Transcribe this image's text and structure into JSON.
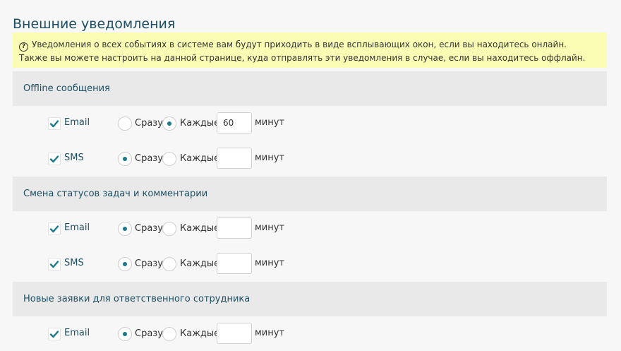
{
  "page": {
    "title": "Внешние уведомления",
    "info_line1": "Уведомления о всех событиях в системе вам будут приходить в виде всплывающих окон, если вы находитесь онлайн.",
    "info_line2": "Также вы можете настроить на данной странице, куда отправлять эти уведомления в случае, если вы находитесь оффлайн."
  },
  "options": {
    "now_label": "Сразу",
    "every_label": "Каждые",
    "unit_label": "минут"
  },
  "sections": [
    {
      "title": "Offline сообщения",
      "rows": [
        {
          "channel": "Email",
          "enabled": true,
          "mode": "every",
          "minutes": "60"
        },
        {
          "channel": "SMS",
          "enabled": true,
          "mode": "now",
          "minutes": ""
        }
      ]
    },
    {
      "title": "Смена статусов задач и комментарии",
      "rows": [
        {
          "channel": "Email",
          "enabled": true,
          "mode": "now",
          "minutes": ""
        },
        {
          "channel": "SMS",
          "enabled": true,
          "mode": "now",
          "minutes": ""
        }
      ]
    },
    {
      "title": "Новые заявки для ответственного сотрудника",
      "rows": [
        {
          "channel": "Email",
          "enabled": true,
          "mode": "now",
          "minutes": ""
        }
      ]
    }
  ],
  "colors": {
    "accent": "#1a7a8c",
    "heading": "#1c4f63",
    "info_background": "#fcfdb4",
    "section_background": "#e9e9e9"
  }
}
